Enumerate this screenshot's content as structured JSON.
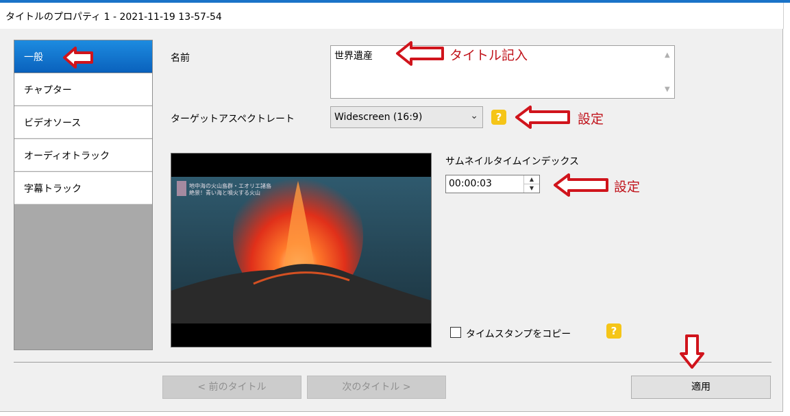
{
  "window": {
    "title": "タイトルのプロパティ 1 - 2021-11-19 13-57-54"
  },
  "nav": {
    "items": [
      {
        "label": "一般",
        "selected": true
      },
      {
        "label": "チャプター",
        "selected": false
      },
      {
        "label": "ビデオソース",
        "selected": false
      },
      {
        "label": "オーディオトラック",
        "selected": false
      },
      {
        "label": "字幕トラック",
        "selected": false
      }
    ]
  },
  "general": {
    "name_label": "名前",
    "name_value": "世界遺産",
    "aspect_label": "ターゲットアスペクトレート",
    "aspect_value": "Widescreen (16:9)",
    "help_glyph": "?",
    "thumbnail_label": "サムネイルタイムインデックス",
    "thumbnail_value": "00:00:03",
    "timestamp_label": "タイムスタンプをコピー",
    "timestamp_checked": false,
    "preview_caption_line1": "地中海の火山島群・エオリエ諸島",
    "preview_caption_line2": "絶景！青い海と噴火する火山"
  },
  "buttons": {
    "prev": "< 前のタイトル",
    "next": "次のタイトル >",
    "apply": "適用"
  },
  "annotations": {
    "title_note": "タイトル記入",
    "aspect_note": "設定",
    "thumbnail_note": "設定"
  },
  "colors": {
    "selection": "#0a62bd",
    "help_icon": "#f5c518",
    "annotation": "#c0121a"
  }
}
